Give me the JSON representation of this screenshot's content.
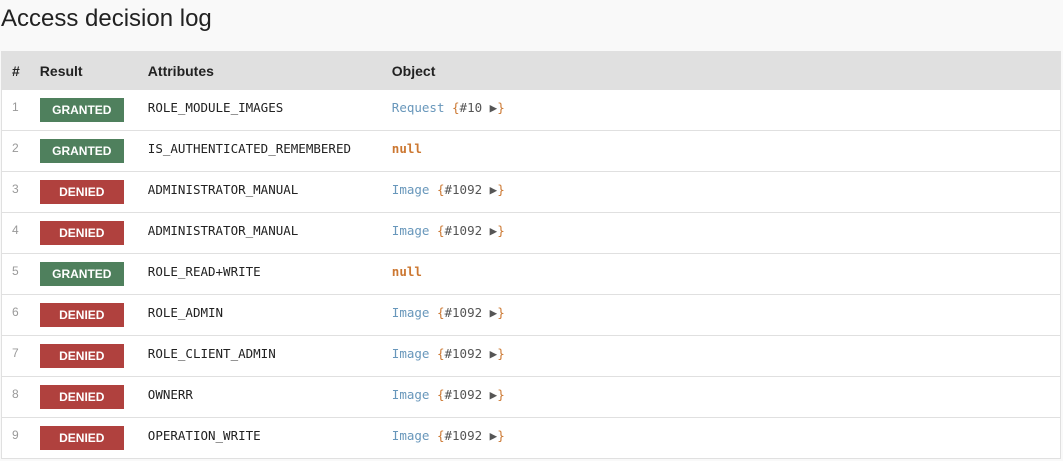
{
  "title": "Access decision log",
  "columns": [
    "#",
    "Result",
    "Attributes",
    "Object"
  ],
  "colors": {
    "granted": "#4f805d",
    "denied": "#b0413e",
    "class": "#6897bb",
    "brace": "#cc7832"
  },
  "rows": [
    {
      "n": "1",
      "result": "GRANTED",
      "attr": "ROLE_MODULE_IMAGES",
      "obj_class": "Request",
      "obj_id": "#10",
      "null": null
    },
    {
      "n": "2",
      "result": "GRANTED",
      "attr": "IS_AUTHENTICATED_REMEMBERED",
      "obj_class": null,
      "obj_id": null,
      "null": "null"
    },
    {
      "n": "3",
      "result": "DENIED",
      "attr": "ADMINISTRATOR_MANUAL",
      "obj_class": "Image",
      "obj_id": "#1092",
      "null": null
    },
    {
      "n": "4",
      "result": "DENIED",
      "attr": "ADMINISTRATOR_MANUAL",
      "obj_class": "Image",
      "obj_id": "#1092",
      "null": null
    },
    {
      "n": "5",
      "result": "GRANTED",
      "attr": "ROLE_READ+WRITE",
      "obj_class": null,
      "obj_id": null,
      "null": "null"
    },
    {
      "n": "6",
      "result": "DENIED",
      "attr": "ROLE_ADMIN",
      "obj_class": "Image",
      "obj_id": "#1092",
      "null": null
    },
    {
      "n": "7",
      "result": "DENIED",
      "attr": "ROLE_CLIENT_ADMIN",
      "obj_class": "Image",
      "obj_id": "#1092",
      "null": null
    },
    {
      "n": "8",
      "result": "DENIED",
      "attr": "OWNERR",
      "obj_class": "Image",
      "obj_id": "#1092",
      "null": null
    },
    {
      "n": "9",
      "result": "DENIED",
      "attr": "OPERATION_WRITE",
      "obj_class": "Image",
      "obj_id": "#1092",
      "null": null
    }
  ]
}
